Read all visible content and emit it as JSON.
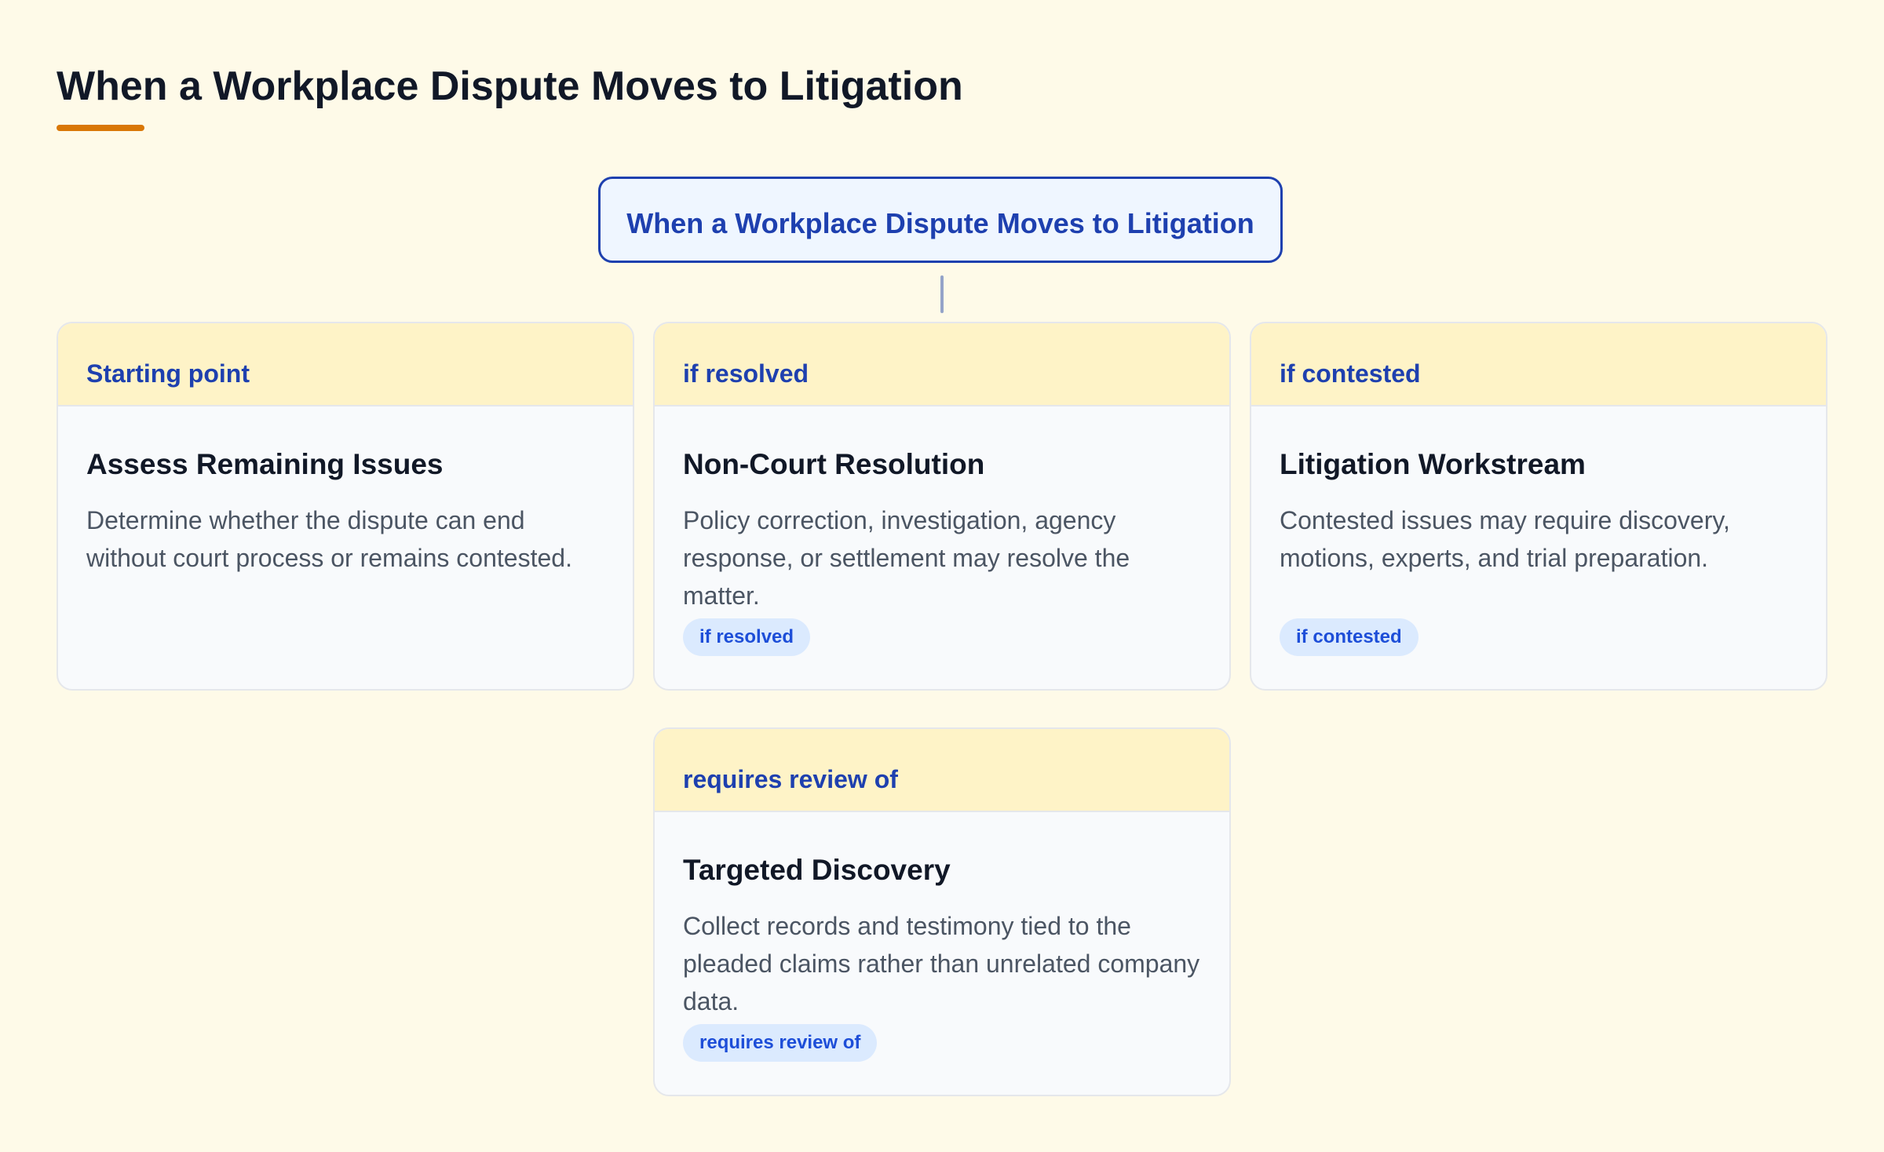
{
  "page": {
    "title": "When a Workplace Dispute Moves to Litigation"
  },
  "root": {
    "label": "When a Workplace Dispute Moves to Litigation"
  },
  "cards": [
    {
      "tag": "Starting point",
      "title": "Assess Remaining Issues",
      "description": "Determine whether the dispute can end without court process or remains contested.",
      "pill": ""
    },
    {
      "tag": "if resolved",
      "title": "Non-Court Resolution",
      "description": "Policy correction, investigation, agency response, or settlement may resolve the matter.",
      "pill": "if resolved"
    },
    {
      "tag": "if contested",
      "title": "Litigation Workstream",
      "description": "Contested issues may require discovery, motions, experts, and trial preparation.",
      "pill": "if contested"
    },
    {
      "tag": "requires review of",
      "title": "Targeted Discovery",
      "description": "Collect records and testimony tied to the pleaded claims rather than unrelated company data.",
      "pill": "requires review of"
    }
  ],
  "colors": {
    "background": "#fefae8",
    "accent": "#d97706",
    "primary": "#1e40af",
    "card_header": "#fef3c7",
    "pill_bg": "#dbeafe",
    "pill_text": "#1d4ed8"
  }
}
